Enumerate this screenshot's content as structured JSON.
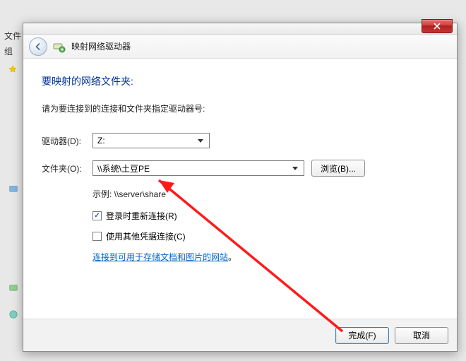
{
  "bg": {
    "tab1": "文件",
    "tab2": "组"
  },
  "window": {
    "title": "映射网络驱动器"
  },
  "dialog": {
    "heading": "要映射的网络文件夹:",
    "instruction": "请为要连接到的连接和文件夹指定驱动器号:",
    "drive_label": "驱动器(D):",
    "drive_value": "Z:",
    "folder_label": "文件夹(O):",
    "folder_value": "\\\\系统\\土豆PE",
    "browse_label": "浏览(B)...",
    "example_label": "示例: \\\\server\\share",
    "reconnect_label": "登录时重新连接(R)",
    "reconnect_checked": true,
    "other_creds_label": "使用其他凭据连接(C)",
    "other_creds_checked": false,
    "link_text": "连接到可用于存储文档和图片的网站",
    "link_period": "。"
  },
  "footer": {
    "finish_label": "完成(F)",
    "cancel_label": "取消"
  }
}
